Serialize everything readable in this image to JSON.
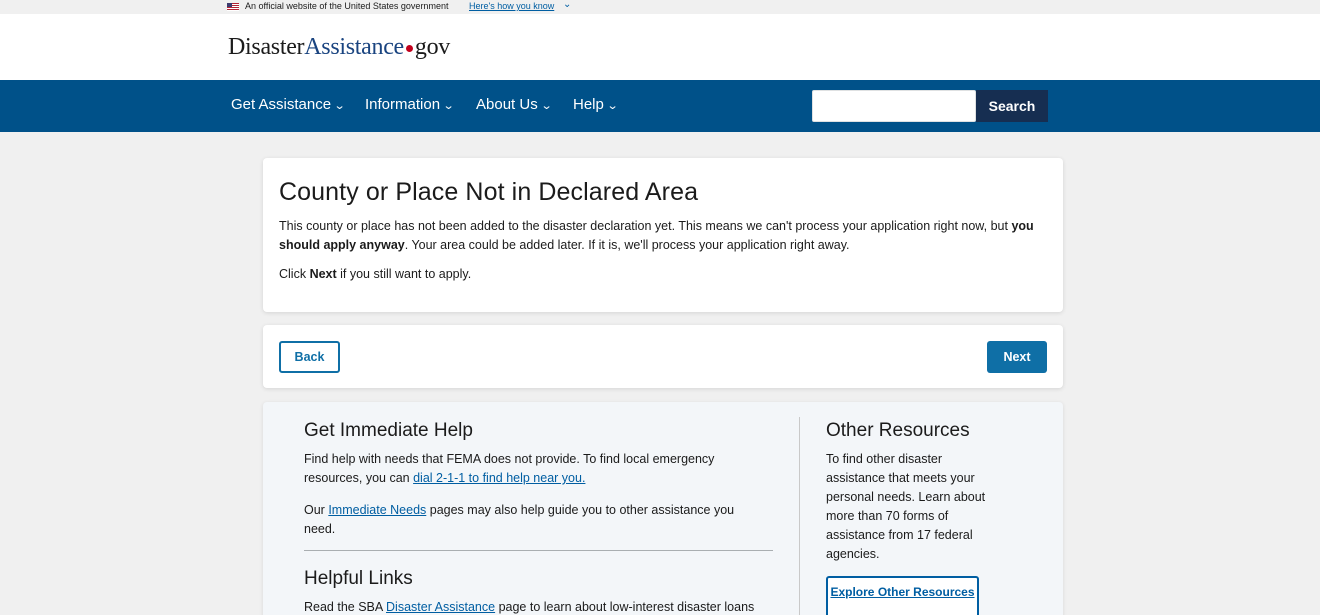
{
  "gov_banner": {
    "official_text": "An official website of the United States government",
    "how_link": "Here's how you know"
  },
  "logo": {
    "part1": "Disaster",
    "part2": "Assistance",
    "part3": "gov"
  },
  "nav": {
    "items": [
      {
        "label": "Get Assistance"
      },
      {
        "label": "Information"
      },
      {
        "label": "About Us"
      },
      {
        "label": "Help"
      }
    ],
    "search_value": "",
    "search_button": "Search"
  },
  "main": {
    "title": "County or Place Not in Declared Area",
    "p1_a": "This county or place has not been added to the disaster declaration yet. This means we can't process your application right now, but ",
    "p1_bold": "you should apply anyway",
    "p1_b": ". Your area could be added later. If it is, we'll process your application right away.",
    "p2_a": "Click ",
    "p2_bold": "Next",
    "p2_b": " if you still want to apply."
  },
  "actions": {
    "back": "Back",
    "next": "Next"
  },
  "help": {
    "immediate_title": "Get Immediate Help",
    "immediate_text": "Find help with needs that FEMA does not provide. To find local emergency resources, you can ",
    "immediate_link": "dial 2-1-1 to find help near you.",
    "needs_a": "Our ",
    "needs_link": "Immediate Needs",
    "needs_b": " pages may also help guide you to other assistance you need.",
    "links_title": "Helpful Links",
    "links_a": "Read the SBA ",
    "links_link": "Disaster Assistance",
    "links_b": " page to learn about low-interest disaster loans",
    "other_title": "Other Resources",
    "other_text": "To find other disaster assistance that meets your personal needs. Learn about more than 70 forms of assistance from 17 federal agencies.",
    "explore_button": "Explore Other Resources"
  }
}
